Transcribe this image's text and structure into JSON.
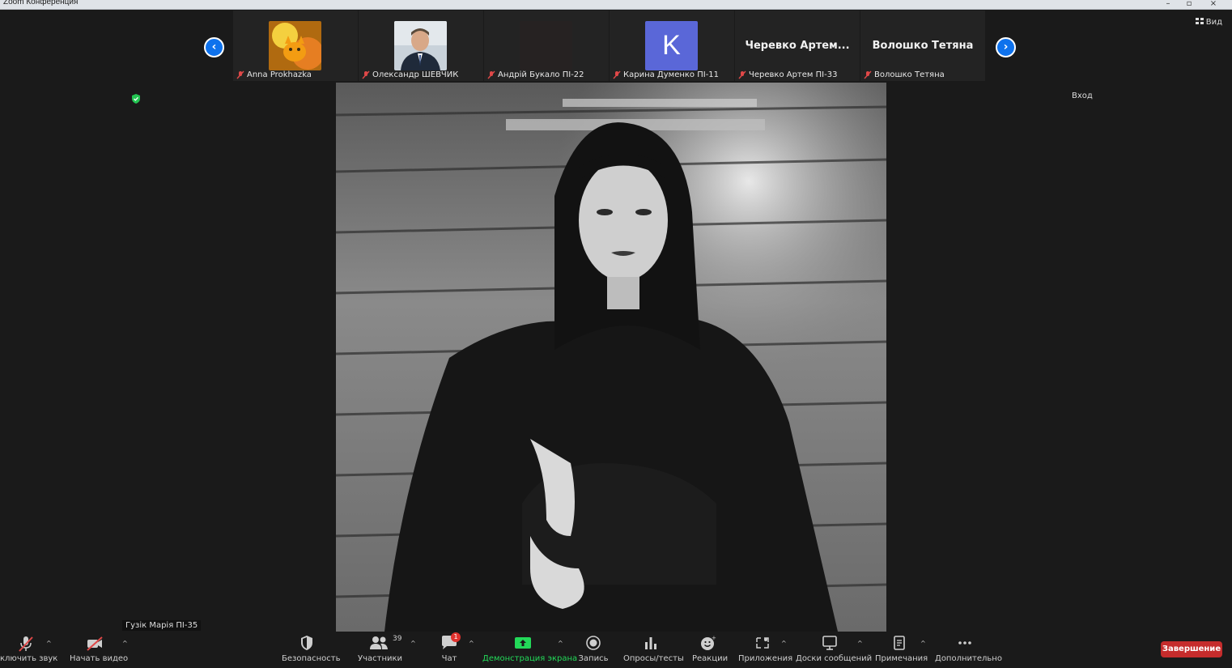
{
  "window": {
    "title": "Zoom Конференция"
  },
  "top": {
    "view_label": "Вид",
    "enter_label": "Вход"
  },
  "participants": [
    {
      "name": "Anna Prokhazka",
      "muted": true,
      "type": "photo-cat"
    },
    {
      "name": "Олександр ШЕВЧИК",
      "muted": true,
      "type": "photo-man"
    },
    {
      "name": "Андрій Букало ПІ-22",
      "muted": true,
      "type": "dark"
    },
    {
      "name": "Карина Думенко ПІ-11",
      "muted": true,
      "type": "initial",
      "initial": "K",
      "color": "#5a67d8"
    },
    {
      "name": "Черевко Артем ПІ-33",
      "muted": true,
      "type": "text",
      "display": "Черевко  Артем..."
    },
    {
      "name": "Волошко Тетяна",
      "muted": true,
      "type": "text",
      "display": "Волошко Тетяна"
    }
  ],
  "active_speaker": {
    "name": "Гузік Марія ПІ-35"
  },
  "toolbar": {
    "mute": "ключить звук",
    "video": "Начать видео",
    "security": "Безопасность",
    "participants": "Участники",
    "participants_count": "39",
    "chat": "Чат",
    "chat_badge": "1",
    "share": "Демонстрация экрана",
    "record": "Запись",
    "polls": "Опросы/тесты",
    "reactions": "Реакции",
    "apps": "Приложения",
    "whiteboard": "Доски сообщений",
    "notes": "Примечания",
    "more": "Дополнительно",
    "end": "Завершение"
  },
  "colors": {
    "accent": "#0e72ed",
    "share_green": "#23d959",
    "end_red": "#c52c2c"
  }
}
